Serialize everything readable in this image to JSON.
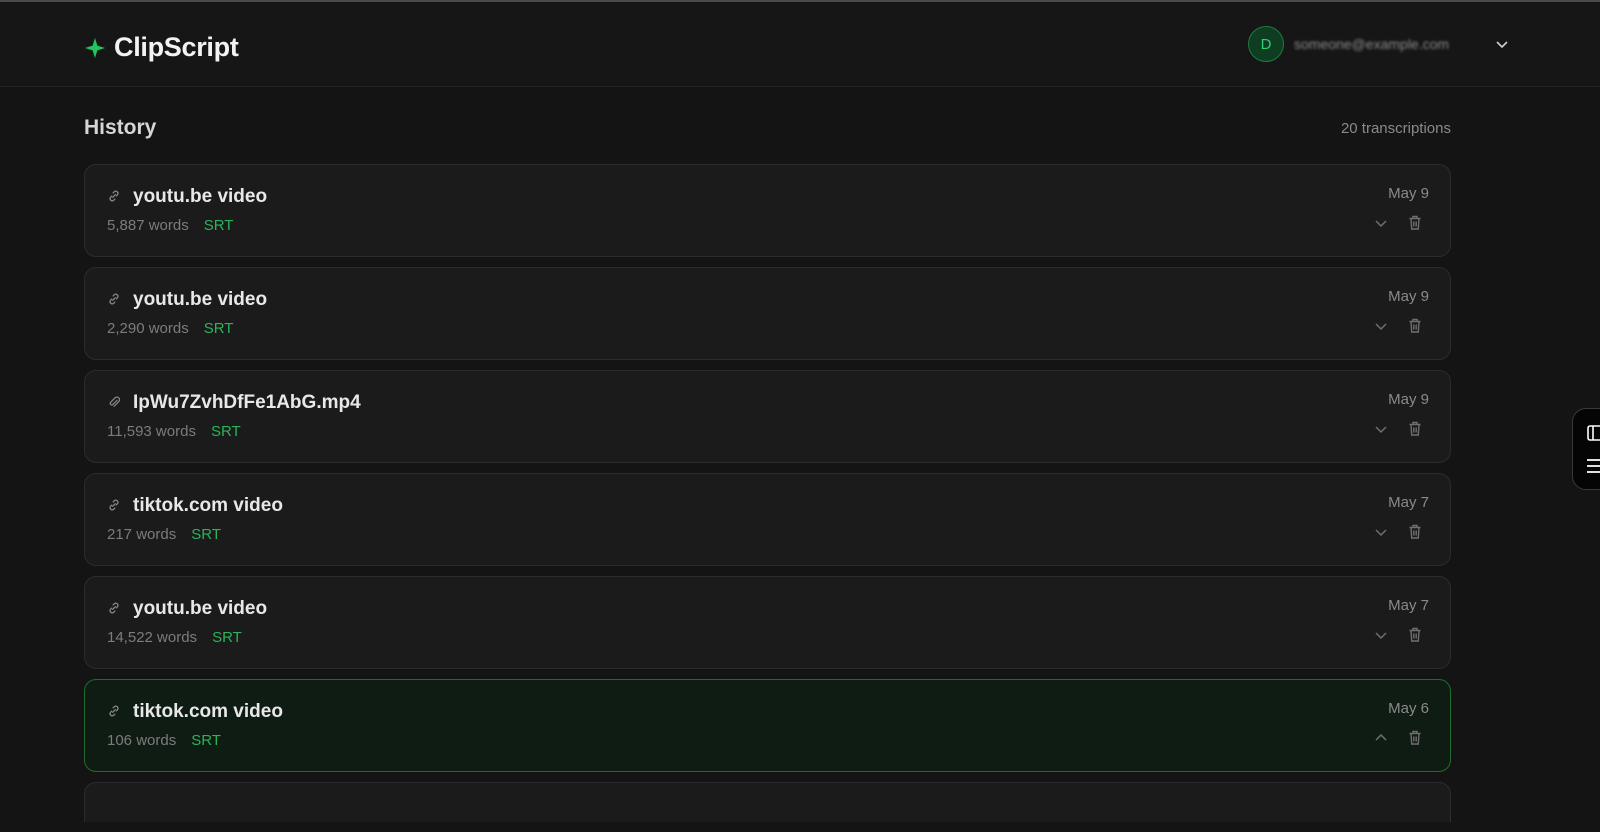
{
  "app": {
    "name": "ClipScript",
    "brand_color": "#22c55e"
  },
  "user": {
    "avatar_initial": "D",
    "display_name": "someone@example.com"
  },
  "history": {
    "title": "History",
    "count_text": "20 transcriptions",
    "items": [
      {
        "icon": "link-icon",
        "title": "youtu.be video",
        "words": "5,887 words",
        "format": "SRT",
        "date": "May 9",
        "expanded": false
      },
      {
        "icon": "link-icon",
        "title": "youtu.be video",
        "words": "2,290 words",
        "format": "SRT",
        "date": "May 9",
        "expanded": false
      },
      {
        "icon": "paperclip-icon",
        "title": "IpWu7ZvhDfFe1AbG.mp4",
        "words": "11,593 words",
        "format": "SRT",
        "date": "May 9",
        "expanded": false
      },
      {
        "icon": "link-icon",
        "title": "tiktok.com video",
        "words": "217 words",
        "format": "SRT",
        "date": "May 7",
        "expanded": false
      },
      {
        "icon": "link-icon",
        "title": "youtu.be video",
        "words": "14,522 words",
        "format": "SRT",
        "date": "May 7",
        "expanded": false
      },
      {
        "icon": "link-icon",
        "title": "tiktok.com video",
        "words": "106 words",
        "format": "SRT",
        "date": "May 6",
        "expanded": true
      }
    ]
  }
}
